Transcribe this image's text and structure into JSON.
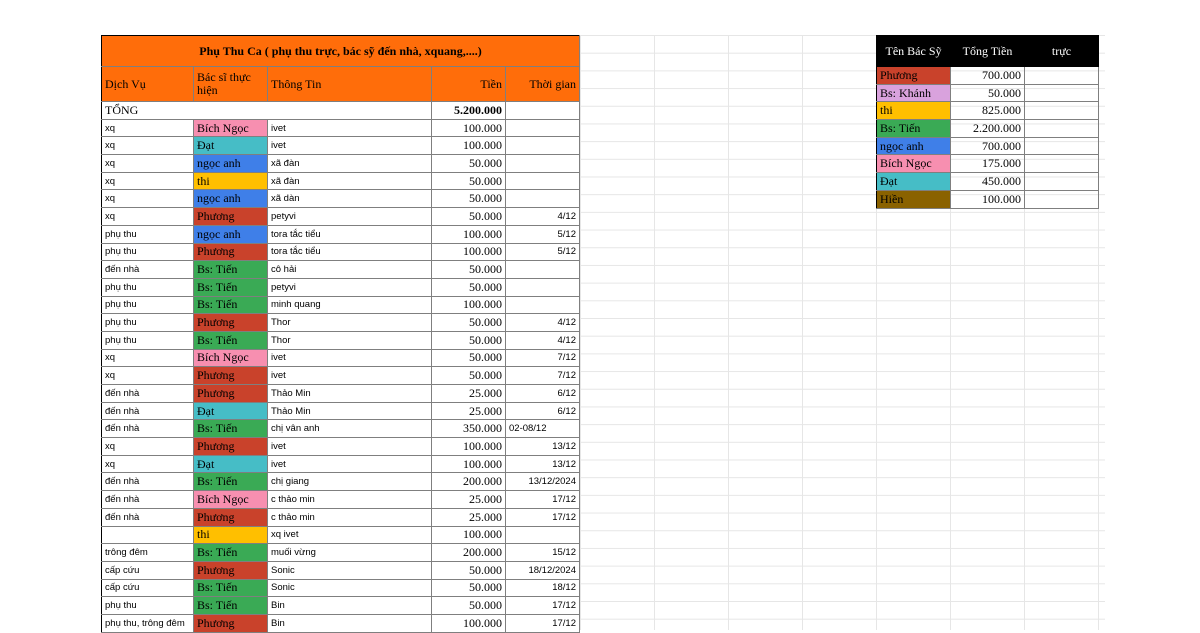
{
  "main": {
    "title": "Phụ Thu Ca ( phụ thu trực, bác sỹ đến nhà, xquang,....)",
    "headers": {
      "service": "Dịch Vụ",
      "doctor": "Bác sĩ thực hiện",
      "info": "Thông Tin",
      "amount": "Tiền",
      "time": "Thời gian"
    },
    "total_label": "TỔNG",
    "total_value": "5.200.000",
    "rows": [
      {
        "service": "xq",
        "doctor": "Bích Ngọc",
        "info": "ivet",
        "amount": "100.000",
        "date": ""
      },
      {
        "service": "xq",
        "doctor": "Đạt",
        "info": "ivet",
        "amount": "100.000",
        "date": ""
      },
      {
        "service": "xq",
        "doctor": "ngọc anh",
        "info": "xã đàn",
        "amount": "50.000",
        "date": ""
      },
      {
        "service": "xq",
        "doctor": "thi",
        "info": "xã đàn",
        "amount": "50.000",
        "date": ""
      },
      {
        "service": "xq",
        "doctor": "ngọc anh",
        "info": "xã  dàn",
        "amount": "50.000",
        "date": ""
      },
      {
        "service": "xq",
        "doctor": "Phương",
        "info": "petyvi",
        "amount": "50.000",
        "date": "4/12"
      },
      {
        "service": "phụ thu",
        "doctor": "ngọc anh",
        "info": "tora tắc tiểu",
        "amount": "100.000",
        "date": "5/12"
      },
      {
        "service": "phụ thu",
        "doctor": "Phương",
        "info": "tora tắc tiểu",
        "amount": "100.000",
        "date": "5/12"
      },
      {
        "service": "đến nhà",
        "doctor": "Bs: Tiến",
        "info": "cô hải",
        "amount": "50.000",
        "date": ""
      },
      {
        "service": "phụ thu",
        "doctor": "Bs: Tiến",
        "info": "petyvi",
        "amount": "50.000",
        "date": ""
      },
      {
        "service": "phụ thu",
        "doctor": "Bs: Tiến",
        "info": "minh quang",
        "amount": "100.000",
        "date": ""
      },
      {
        "service": "phụ thu",
        "doctor": "Phương",
        "info": "Thor",
        "amount": "50.000",
        "date": "4/12"
      },
      {
        "service": "phụ thu",
        "doctor": "Bs: Tiến",
        "info": "Thor",
        "amount": "50.000",
        "date": "4/12"
      },
      {
        "service": "xq",
        "doctor": "Bích Ngọc",
        "info": "ivet",
        "amount": "50.000",
        "date": "7/12"
      },
      {
        "service": "xq",
        "doctor": "Phương",
        "info": "ivet",
        "amount": "50.000",
        "date": "7/12"
      },
      {
        "service": "đến nhà",
        "doctor": "Phương",
        "info": "Thảo Min",
        "amount": "25.000",
        "date": "6/12"
      },
      {
        "service": "đến nhà",
        "doctor": "Đạt",
        "info": "Thảo Min",
        "amount": "25.000",
        "date": "6/12"
      },
      {
        "service": "đến nhà",
        "doctor": "Bs: Tiến",
        "info": "chị vân anh",
        "amount": "350.000",
        "date": "02-08/12"
      },
      {
        "service": "xq",
        "doctor": "Phương",
        "info": "ivet",
        "amount": "100.000",
        "date": "13/12"
      },
      {
        "service": "xq",
        "doctor": "Đạt",
        "info": "ivet",
        "amount": "100.000",
        "date": "13/12"
      },
      {
        "service": "đến nhà",
        "doctor": "Bs: Tiến",
        "info": "chị giang",
        "amount": "200.000",
        "date": "13/12/2024"
      },
      {
        "service": "đến nhà",
        "doctor": "Bích Ngọc",
        "info": "c thảo min",
        "amount": "25.000",
        "date": "17/12"
      },
      {
        "service": "đến nhà",
        "doctor": "Phương",
        "info": "c thảo min",
        "amount": "25.000",
        "date": "17/12"
      },
      {
        "service": "",
        "doctor": "thi",
        "info": "xq ivet",
        "amount": "100.000",
        "date": ""
      },
      {
        "service": "trông đêm",
        "doctor": "Bs: Tiến",
        "info": "muối vừng",
        "amount": "200.000",
        "date": "15/12"
      },
      {
        "service": "cấp cứu",
        "doctor": "Phương",
        "info": "Sonic",
        "amount": "50.000",
        "date": "18/12/2024"
      },
      {
        "service": "cấp cứu",
        "doctor": "Bs: Tiến",
        "info": "Sonic",
        "amount": "50.000",
        "date": "18/12"
      },
      {
        "service": "phụ thu",
        "doctor": "Bs: Tiến",
        "info": "Bin",
        "amount": "50.000",
        "date": "17/12"
      },
      {
        "service": "phụ thu, trông đêm",
        "doctor": "Phương",
        "info": "Bin",
        "amount": "100.000",
        "date": "17/12"
      }
    ]
  },
  "summary": {
    "headers": {
      "doctor": "Tên Bác Sỹ",
      "total": "Tổng Tiền",
      "duty": "trực"
    },
    "rows": [
      {
        "doctor": "Phương",
        "total": "700.000",
        "duty": ""
      },
      {
        "doctor": "Bs: Khánh",
        "total": "50.000",
        "duty": ""
      },
      {
        "doctor": "thi",
        "total": "825.000",
        "duty": ""
      },
      {
        "doctor": "Bs: Tiến",
        "total": "2.200.000",
        "duty": ""
      },
      {
        "doctor": "ngọc anh",
        "total": "700.000",
        "duty": ""
      },
      {
        "doctor": "Bích Ngọc",
        "total": "175.000",
        "duty": ""
      },
      {
        "doctor": "Đạt",
        "total": "450.000",
        "duty": ""
      },
      {
        "doctor": "Hiền",
        "total": "100.000",
        "duty": ""
      }
    ]
  },
  "doctor_colors": {
    "Phương": "#c9422b",
    "Bs: Khánh": "#d9a2dd",
    "thi": "#ffbf00",
    "Bs: Tiến": "#3aaa55",
    "ngọc anh": "#3f7fe8",
    "Bích Ngọc": "#f78fb0",
    "Đạt": "#46bdc6",
    "Hiền": "#8a6200"
  },
  "colors": {
    "header_orange": "#ff6d0a",
    "summary_header": "#000000"
  }
}
